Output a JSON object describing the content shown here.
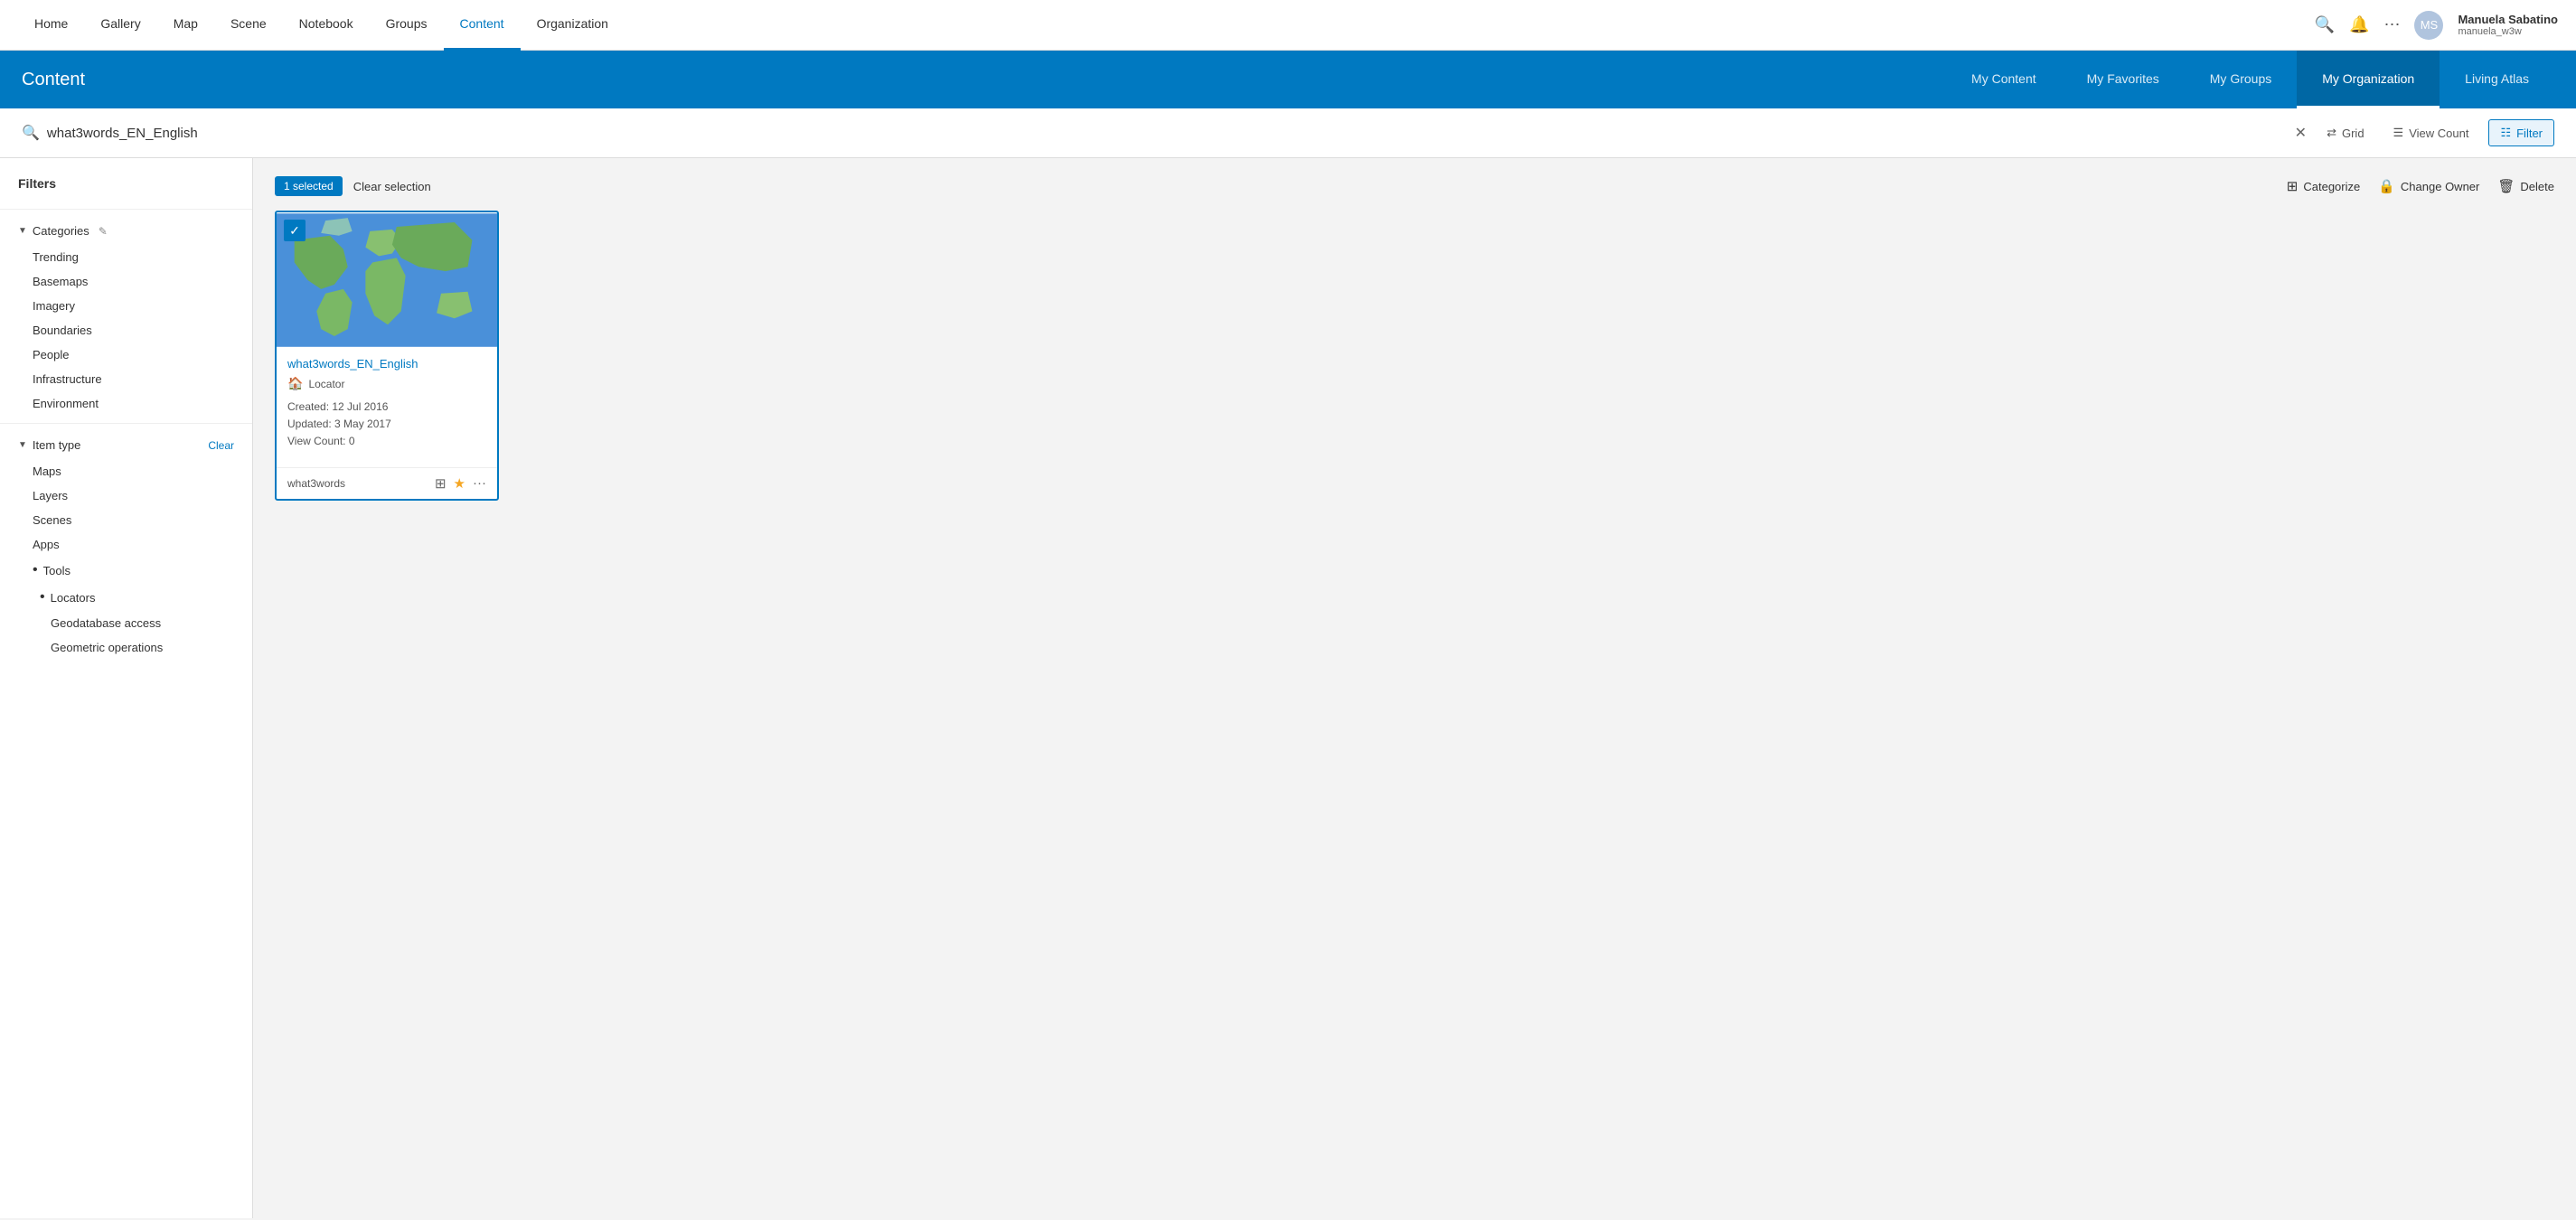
{
  "topNav": {
    "links": [
      {
        "label": "Home",
        "active": false
      },
      {
        "label": "Gallery",
        "active": false
      },
      {
        "label": "Map",
        "active": false
      },
      {
        "label": "Scene",
        "active": false
      },
      {
        "label": "Notebook",
        "active": false
      },
      {
        "label": "Groups",
        "active": false
      },
      {
        "label": "Content",
        "active": true
      },
      {
        "label": "Organization",
        "active": false
      }
    ],
    "user": {
      "name": "Manuela Sabatino",
      "handle": "manuela_w3w",
      "initials": "MS"
    }
  },
  "contentHeader": {
    "title": "Content",
    "tabs": [
      {
        "label": "My Content",
        "active": false
      },
      {
        "label": "My Favorites",
        "active": false
      },
      {
        "label": "My Groups",
        "active": false
      },
      {
        "label": "My Organization",
        "active": true
      },
      {
        "label": "Living Atlas",
        "active": false
      }
    ]
  },
  "searchBar": {
    "value": "what3words_EN_English",
    "placeholder": "Search content",
    "gridLabel": "Grid",
    "viewCountLabel": "View Count",
    "filterLabel": "Filter"
  },
  "filters": {
    "title": "Filters",
    "categories": {
      "label": "Categories",
      "items": [
        "Trending",
        "Basemaps",
        "Imagery",
        "Boundaries",
        "People",
        "Infrastructure",
        "Environment"
      ]
    },
    "itemType": {
      "label": "Item type",
      "clearLabel": "Clear",
      "items": [
        {
          "label": "Maps",
          "bullet": false
        },
        {
          "label": "Layers",
          "bullet": false
        },
        {
          "label": "Scenes",
          "bullet": false
        },
        {
          "label": "Apps",
          "bullet": false
        },
        {
          "label": "Tools",
          "bullet": true,
          "active": true
        },
        {
          "label": "Locators",
          "bullet": true,
          "active": true,
          "sub": true
        },
        {
          "label": "Geodatabase access",
          "sub2": true
        },
        {
          "label": "Geometric operations",
          "sub2": true
        }
      ]
    }
  },
  "selectionBar": {
    "selectedCount": "1 selected",
    "clearSelectionLabel": "Clear selection",
    "actions": [
      {
        "label": "Categorize",
        "icon": "⊞"
      },
      {
        "label": "Change Owner",
        "icon": "🔒"
      },
      {
        "label": "Delete",
        "icon": "🗑"
      }
    ]
  },
  "cards": [
    {
      "title": "what3words_EN_English",
      "type": "Locator",
      "created": "Created: 12 Jul 2016",
      "updated": "Updated: 3 May 2017",
      "viewCount": "View Count: 0",
      "tag": "what3words",
      "selected": true
    }
  ]
}
